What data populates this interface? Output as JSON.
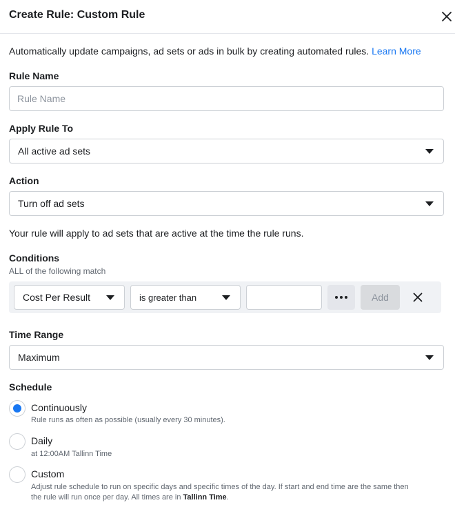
{
  "dialog": {
    "title": "Create Rule: Custom Rule",
    "intro": "Automatically update campaigns, ad sets or ads in bulk by creating automated rules. ",
    "learn_more": "Learn More"
  },
  "rule_name": {
    "label": "Rule Name",
    "value": "",
    "placeholder": "Rule Name"
  },
  "apply_rule_to": {
    "label": "Apply Rule To",
    "selected": "All active ad sets"
  },
  "action": {
    "label": "Action",
    "selected": "Turn off ad sets"
  },
  "note": "Your rule will apply to ad sets that are active at the time the rule runs.",
  "conditions": {
    "label": "Conditions",
    "sublabel": "ALL of the following match",
    "metric": "Cost Per Result",
    "operator": "is greater than",
    "value": "",
    "add_label": "Add"
  },
  "time_range": {
    "label": "Time Range",
    "selected": "Maximum"
  },
  "schedule": {
    "label": "Schedule",
    "options": [
      {
        "title": "Continuously",
        "desc": "Rule runs as often as possible (usually every 30 minutes).",
        "checked": true
      },
      {
        "title": "Daily",
        "desc": "at 12:00AM Tallinn Time",
        "checked": false
      },
      {
        "title": "Custom",
        "desc_line1": "Adjust rule schedule to run on specific days and specific times of the day. If start and end time are the same then",
        "desc_line2": "the rule will run once per day. All times are in ",
        "desc_bold": "Tallinn Time",
        "desc_end": ".",
        "checked": false
      }
    ]
  },
  "colors": {
    "accent": "#1877f2",
    "border": "#ccd0d5",
    "text": "#1c1e21",
    "muted": "#606770",
    "row_bg": "#f0f2f5"
  }
}
